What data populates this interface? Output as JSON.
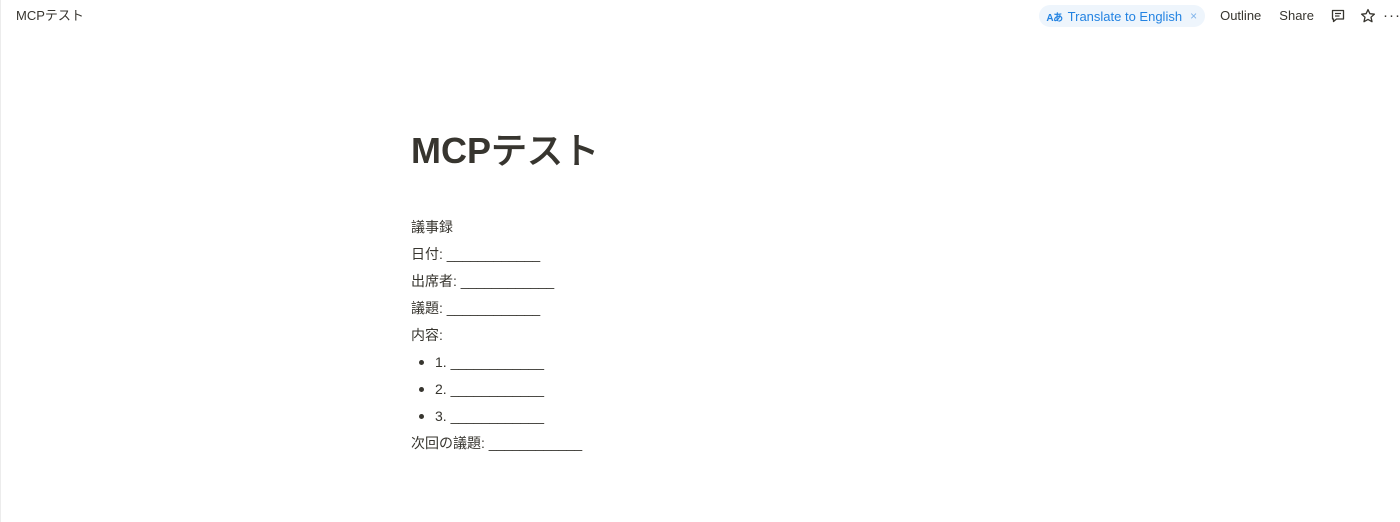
{
  "header": {
    "breadcrumb": "MCPテスト",
    "translate": {
      "icon_text": "Aあ",
      "label": "Translate to English",
      "close": "×"
    },
    "outline_label": "Outline",
    "share_label": "Share",
    "comment_icon": "comment-icon",
    "star_icon": "star-icon",
    "more_label": "···"
  },
  "document": {
    "title": "MCPテスト",
    "lines": {
      "heading": "議事録",
      "date": "日付: ____________",
      "attendees": "出席者: ____________",
      "agenda": "議題: ____________",
      "content": "内容:"
    },
    "items": [
      "1. ____________",
      "2. ____________",
      "3. ____________"
    ],
    "next_agenda": "次回の議題: ____________"
  },
  "colors": {
    "text": "#37352f",
    "accent": "#2383e2",
    "pill_bg": "#eef5fc"
  }
}
